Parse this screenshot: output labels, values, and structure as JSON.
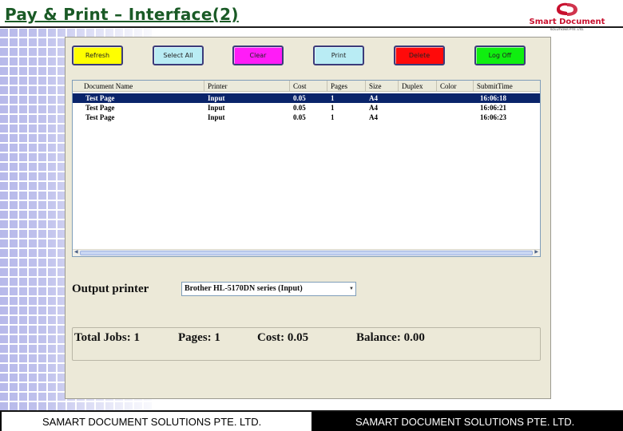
{
  "slide": {
    "title": "Pay & Print – Interface(2)",
    "logo_text": "Smart Document",
    "logo_sub": "SOLUTIONS PTE. LTD.",
    "footer_left": "SAMART DOCUMENT SOLUTIONS PTE. LTD.",
    "footer_right": "SAMART DOCUMENT SOLUTIONS PTE. LTD."
  },
  "toolbar": {
    "refresh": "Refresh",
    "select_all": "Select All",
    "clear": "Clear",
    "print": "Print",
    "delete": "Delete",
    "log_off": "Log Off"
  },
  "job_list": {
    "columns": [
      "Document Name",
      "Printer",
      "Cost",
      "Pages",
      "Size",
      "Duplex",
      "Color",
      "SubmitTime"
    ],
    "rows": [
      {
        "name": "Test Page",
        "printer": "Input",
        "cost": "0.05",
        "pages": "1",
        "size": "A4",
        "duplex": "",
        "color": "",
        "time": "16:06:18",
        "selected": true
      },
      {
        "name": "Test Page",
        "printer": "Input",
        "cost": "0.05",
        "pages": "1",
        "size": "A4",
        "duplex": "",
        "color": "",
        "time": "16:06:21",
        "selected": false
      },
      {
        "name": "Test Page",
        "printer": "Input",
        "cost": "0.05",
        "pages": "1",
        "size": "A4",
        "duplex": "",
        "color": "",
        "time": "16:06:23",
        "selected": false
      }
    ]
  },
  "output": {
    "label": "Output printer",
    "selected_printer": "Brother HL-5170DN series (Input)"
  },
  "summary": {
    "total_jobs": "Total Jobs: 1",
    "pages": "Pages: 1",
    "cost": "Cost: 0.05",
    "balance": "Balance: 0.00"
  },
  "colors": {
    "title_green": "#1a5a26",
    "selection_blue": "#0a246a",
    "refresh_yellow": "#ffff00",
    "clear_magenta": "#ff1cf7",
    "delete_red": "#ff0a0a",
    "logoff_green": "#10ee10",
    "select_cyan": "#b9ecf4"
  },
  "icons": {
    "check": "check-icon",
    "dropdown": "chevron-down-icon"
  }
}
